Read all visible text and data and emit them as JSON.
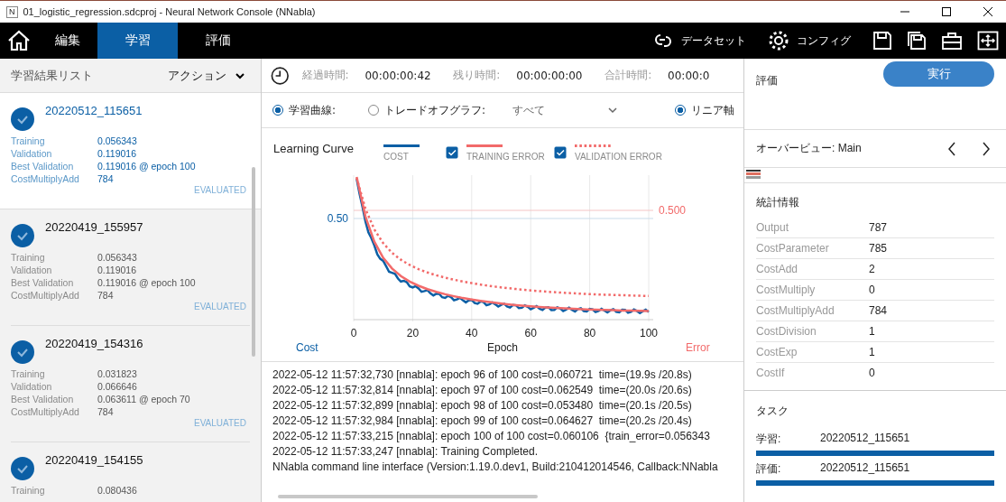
{
  "window": {
    "app_icon": "N",
    "title": "01_logistic_regression.sdcproj - Neural Network Console (NNabla)"
  },
  "nav": {
    "tabs": [
      {
        "label": "編集",
        "selected": false
      },
      {
        "label": "学習",
        "selected": true
      },
      {
        "label": "評価",
        "selected": false
      }
    ],
    "dataset": "データセット",
    "config": "コンフィグ"
  },
  "results": {
    "title": "学習結果リスト",
    "action": "アクション",
    "items": [
      {
        "name": "20220512_115651",
        "selected": true,
        "metrics": [
          {
            "label": "Training",
            "value": "0.056343"
          },
          {
            "label": "Validation",
            "value": "0.119016"
          },
          {
            "label": "Best Validation",
            "value": "0.119016 @ epoch 100"
          },
          {
            "label": "CostMultiplyAdd",
            "value": "784"
          }
        ],
        "status": "EVALUATED"
      },
      {
        "name": "20220419_155957",
        "selected": false,
        "metrics": [
          {
            "label": "Training",
            "value": "0.056343"
          },
          {
            "label": "Validation",
            "value": "0.119016"
          },
          {
            "label": "Best Validation",
            "value": "0.119016 @ epoch 100"
          },
          {
            "label": "CostMultiplyAdd",
            "value": "784"
          }
        ],
        "status": "EVALUATED"
      },
      {
        "name": "20220419_154316",
        "selected": false,
        "metrics": [
          {
            "label": "Training",
            "value": "0.031823"
          },
          {
            "label": "Validation",
            "value": "0.066646"
          },
          {
            "label": "Best Validation",
            "value": "0.063611 @ epoch 70"
          },
          {
            "label": "CostMultiplyAdd",
            "value": "784"
          }
        ],
        "status": "EVALUATED"
      },
      {
        "name": "20220419_154155",
        "selected": false,
        "metrics": [
          {
            "label": "Training",
            "value": "0.080436"
          }
        ]
      }
    ]
  },
  "times": [
    {
      "label": "経過時間:",
      "value": "00:00:00:42"
    },
    {
      "label": "残り時間:",
      "value": "00:00:00:00"
    },
    {
      "label": "合計時間:",
      "value": "00:00:0"
    }
  ],
  "graph_options": {
    "modes": [
      {
        "label": "学習曲線:",
        "selected": true
      },
      {
        "label": "トレードオフグラフ:",
        "selected": false
      }
    ],
    "filter": "すべて",
    "axis": {
      "label": "リニア軸",
      "selected": true
    }
  },
  "learning_curve": {
    "title": "Learning Curve",
    "legend": [
      {
        "label": "COST",
        "kind": "solid",
        "color": "#0b5fa5"
      },
      {
        "label": "TRAINING ERROR",
        "kind": "solid",
        "color": "#f26a6a",
        "checked": true
      },
      {
        "label": "VALIDATION ERROR",
        "kind": "dotted",
        "color": "#f26a6a",
        "checked": true
      }
    ],
    "cost_tick": "0.50",
    "error_tick": "0.500",
    "xticks": [
      "0",
      "20",
      "40",
      "60",
      "80",
      "100"
    ],
    "ylabel_left": "Cost",
    "xlabel": "Epoch",
    "ylabel_right": "Error"
  },
  "log": [
    "2022-05-12 11:57:32,730 [nnabla]: epoch 96 of 100 cost=0.060721  time=(19.9s /20.8s)",
    "2022-05-12 11:57:32,814 [nnabla]: epoch 97 of 100 cost=0.062549  time=(20.0s /20.6s)",
    "2022-05-12 11:57:32,899 [nnabla]: epoch 98 of 100 cost=0.053480  time=(20.1s /20.5s)",
    "2022-05-12 11:57:32,984 [nnabla]: epoch 99 of 100 cost=0.064627  time=(20.2s /20.4s)",
    "2022-05-12 11:57:33,215 [nnabla]: epoch 100 of 100 cost=0.060106  {train_error=0.056343",
    "2022-05-12 11:57:33,247 [nnabla]: Training Completed.",
    "NNabla command line interface (Version:1.19.0.dev1, Build:210412014546, Callback:NNabla"
  ],
  "evaluation": {
    "title": "評価",
    "run": "実行",
    "overview": "オーバービュー: Main",
    "stats_title": "統計情報",
    "stats": [
      {
        "label": "Output",
        "value": "787"
      },
      {
        "label": "CostParameter",
        "value": "785"
      },
      {
        "label": "CostAdd",
        "value": "2"
      },
      {
        "label": "CostMultiply",
        "value": "0"
      },
      {
        "label": "CostMultiplyAdd",
        "value": "784"
      },
      {
        "label": "CostDivision",
        "value": "1"
      },
      {
        "label": "CostExp",
        "value": "1"
      },
      {
        "label": "CostIf",
        "value": "0"
      }
    ],
    "tasks_title": "タスク",
    "tasks": [
      {
        "label": "学習:",
        "value": "20220512_115651",
        "level": 1
      },
      {
        "label": "評価:",
        "value": "20220512_115651",
        "level": 1
      }
    ]
  }
}
